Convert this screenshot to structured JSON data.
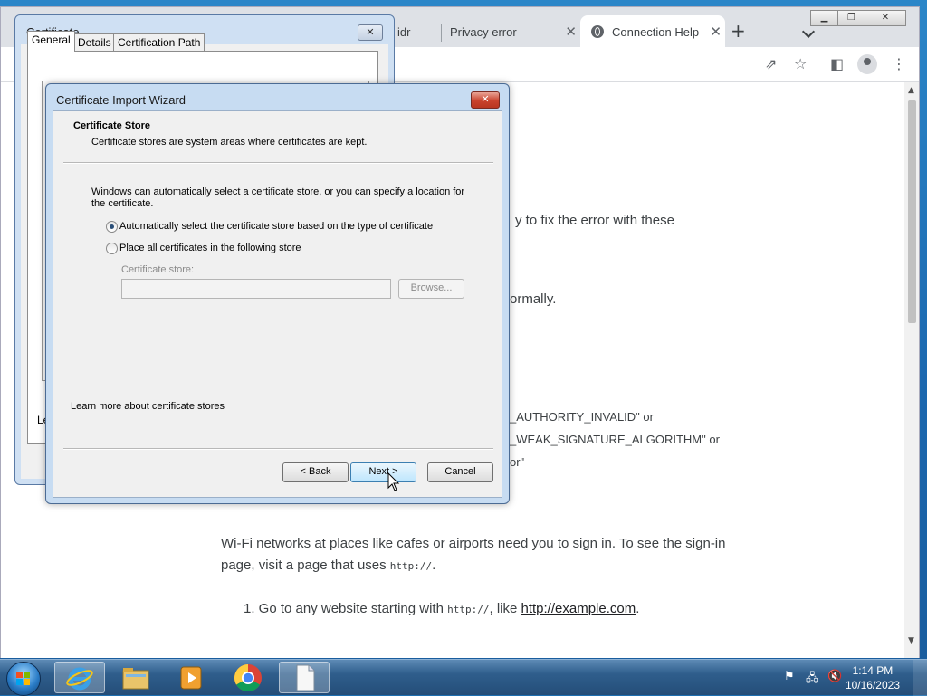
{
  "browser": {
    "tabs": [
      {
        "label": "idr"
      },
      {
        "label": "Privacy error"
      },
      {
        "label": "Connection Help"
      }
    ],
    "new_tab": "+",
    "content_lines": {
      "fix": "y to fix the error with these",
      "normally": "ormally.",
      "authority": "_AUTHORITY_INVALID\" or",
      "weak": "_WEAK_SIGNATURE_ALGORITHM\" or",
      "or": "or\"",
      "wifi_1": "Wi-Fi networks at places like cafes or airports need you to sign in. To see the sign-in",
      "wifi_2_pre": "page, visit a page that uses ",
      "wifi_2_code": "http://",
      "wifi_2_post": ".",
      "step_1_pre": "1. Go to any website starting with ",
      "step_1_code": "http://",
      "step_1_mid": ", like ",
      "step_1_link": "http://example.com",
      "step_1_post": "."
    }
  },
  "certificate_dialog": {
    "title": "Certificate",
    "tabs": [
      "General",
      "Details",
      "Certification Path"
    ],
    "partial_label": "Le"
  },
  "wizard": {
    "title": "Certificate Import Wizard",
    "heading": "Certificate Store",
    "subheading": "Certificate stores are system areas where certificates are kept.",
    "intro_line1": "Windows can automatically select a certificate store, or you can specify a location for",
    "intro_line2": "the certificate.",
    "radio_auto": "Automatically select the certificate store based on the type of certificate",
    "radio_place": "Place all certificates in the following store",
    "store_label": "Certificate store:",
    "store_value": "",
    "browse_button": "Browse...",
    "learn_more_prefix": "Learn more about ",
    "learn_more_link": "certificate stores",
    "back_button": "< Back",
    "next_button": "Next >",
    "cancel_button": "Cancel",
    "selected_option": "auto"
  },
  "taskbar": {
    "clock_time": "1:14 PM",
    "clock_date": "10/16/2023"
  }
}
